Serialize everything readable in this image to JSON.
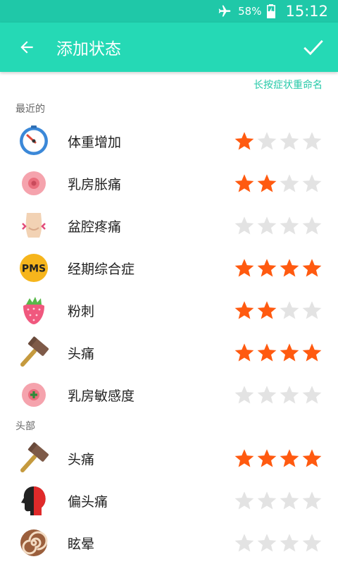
{
  "status_bar": {
    "battery": "58%",
    "time": "15:12"
  },
  "app_bar": {
    "title": "添加状态"
  },
  "hint": "长按症状重命名",
  "colors": {
    "primary": "#25d9b5",
    "status_bar": "#1fc8a8",
    "star_on": "#ff5a10",
    "star_off": "#e3e3e3"
  },
  "sections": [
    {
      "header": "最近的",
      "items": [
        {
          "label": "体重增加",
          "icon": "scale-icon",
          "rating": 1
        },
        {
          "label": "乳房胀痛",
          "icon": "breast-icon",
          "rating": 2
        },
        {
          "label": "盆腔疼痛",
          "icon": "pelvis-icon",
          "rating": 0
        },
        {
          "label": "经期综合症",
          "icon": "pms-icon",
          "rating": 4
        },
        {
          "label": "粉刺",
          "icon": "strawberry-icon",
          "rating": 2
        },
        {
          "label": "头痛",
          "icon": "hammer-icon",
          "rating": 4
        },
        {
          "label": "乳房敏感度",
          "icon": "breast-plus-icon",
          "rating": 0
        }
      ]
    },
    {
      "header": "头部",
      "items": [
        {
          "label": "头痛",
          "icon": "hammer-icon",
          "rating": 4
        },
        {
          "label": "偏头痛",
          "icon": "migraine-head-icon",
          "rating": 0
        },
        {
          "label": "眩晕",
          "icon": "spiral-icon",
          "rating": 0
        }
      ]
    }
  ]
}
